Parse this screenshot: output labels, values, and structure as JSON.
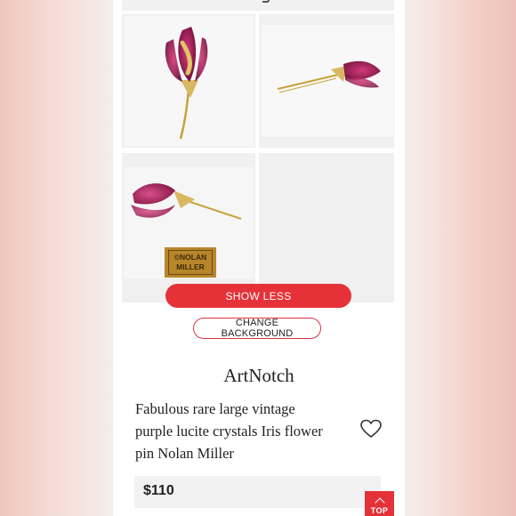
{
  "listing": {
    "photos": [
      {
        "alt": "flower-brooch-front"
      },
      {
        "alt": "flower-brooch-side"
      },
      {
        "alt": "flower-brooch-horizontal"
      }
    ],
    "signature_stamp": "©NOLAN MILLER",
    "show_less_label": "SHOW LESS",
    "change_background_label": "CHANGE BACKGROUND",
    "brand": "ArtNotch",
    "title": "Fabulous rare large vintage purple lucite crystals Iris flower pin Nolan Miller",
    "price": "$110",
    "top_button_label": "TOP"
  },
  "colors": {
    "accent": "#e53238",
    "petal": "#8e1a4d",
    "gold": "#c9a13a"
  },
  "icons": {
    "favorite": "heart-outline-icon",
    "top": "chevron-up-icon"
  }
}
